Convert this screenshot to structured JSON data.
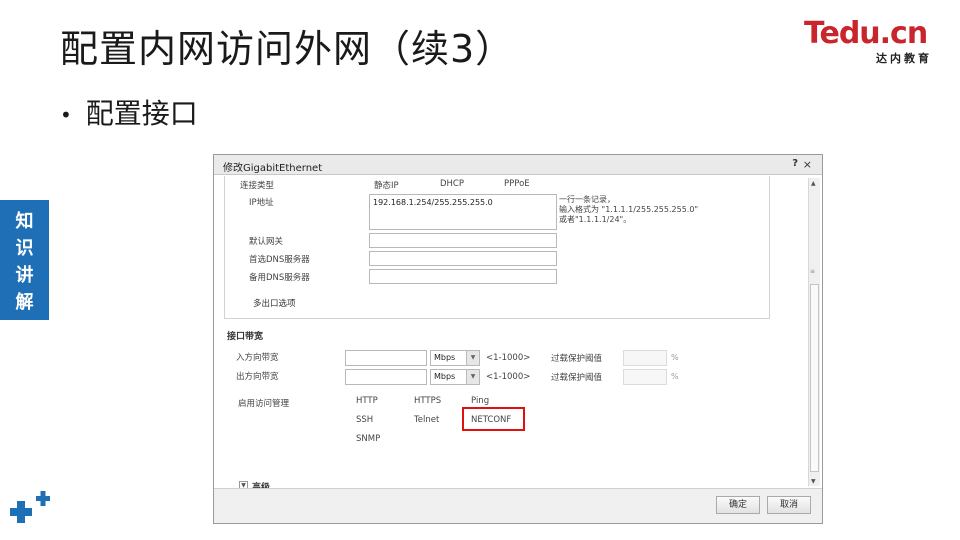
{
  "slide": {
    "title": "配置内网访问外网（续3）",
    "bullet": "配置接口",
    "side_tab": [
      "知",
      "识",
      "讲",
      "解"
    ]
  },
  "logo": {
    "main": "Tedu.cn",
    "sub": "达内教育"
  },
  "dialog": {
    "title": "修改GigabitEthernet",
    "help": "?",
    "close": "×",
    "conn_type": {
      "label": "连接类型",
      "options": [
        "静态IP",
        "DHCP",
        "PPPoE"
      ]
    },
    "ip": {
      "label": "IP地址",
      "value": "192.168.1.254/255.255.255.0",
      "hint": [
        "一行一条记录，",
        "输入格式为 \"1.1.1.1/255.255.255.0\"",
        "或者\"1.1.1.1/24\"。"
      ]
    },
    "gateway": {
      "label": "默认网关",
      "value": ""
    },
    "dns1": {
      "label": "首选DNS服务器",
      "value": ""
    },
    "dns2": {
      "label": "备用DNS服务器",
      "value": ""
    },
    "multi_exit": "多出口选项",
    "bandwidth": {
      "title": "接口带宽",
      "in": {
        "label": "入方向带宽",
        "unit": "Mbps",
        "range": "<1-1000>",
        "protect_label": "过载保护阈值",
        "pct": "%"
      },
      "out": {
        "label": "出方向带宽",
        "unit": "Mbps",
        "range": "<1-1000>",
        "protect_label": "过载保护阈值",
        "pct": "%"
      }
    },
    "access": {
      "label": "启用访问管理",
      "items": [
        "HTTP",
        "HTTPS",
        "Ping",
        "SSH",
        "Telnet",
        "NETCONF",
        "SNMP"
      ]
    },
    "advanced": {
      "toggle": "▼",
      "label": "高级"
    },
    "buttons": {
      "ok": "确定",
      "cancel": "取消"
    }
  },
  "colors": {
    "side_tab": "#1f6fb6",
    "logo_red": "#c8252c",
    "highlight": "#e01010"
  }
}
